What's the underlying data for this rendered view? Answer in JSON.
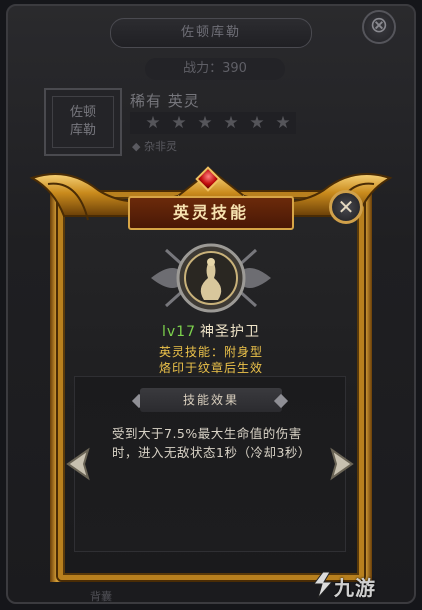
{
  "background": {
    "title": "佐顿库勒",
    "close_glyph": "⊗",
    "power": "战力：390",
    "portrait_text": "佐顿\n库勒",
    "quality": "稀有  英灵",
    "stars": [
      "★",
      "★",
      "★",
      "★",
      "★",
      "★"
    ],
    "element": "◆ 杂非灵",
    "bottom_text": "背囊"
  },
  "dialog": {
    "title": "英灵技能",
    "close_glyph": "✕",
    "skill_level": "lv17",
    "skill_name": "神圣护卫",
    "skill_type": "英灵技能：附身型",
    "skill_condition": "烙印于纹章后生效",
    "effect_header": "技能效果",
    "effect_text": "受到大于7.5%最大生命值的伤害时，进入无敌状态1秒（冷却3秒）"
  },
  "watermark": {
    "text": "九游"
  },
  "colors": {
    "gold": "#d7a546",
    "banner": "#5a1e08",
    "level_green": "#7dd24d",
    "type_yellow": "#ecc24a"
  }
}
